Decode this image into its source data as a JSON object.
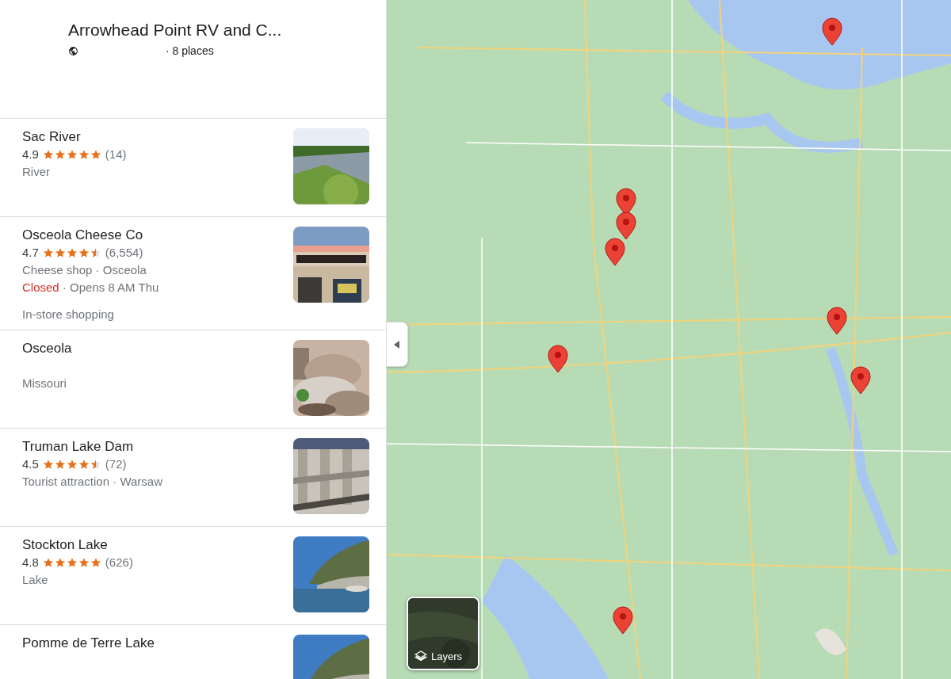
{
  "list": {
    "title": "Arrowhead Point RV and C...",
    "count": "· 8 places"
  },
  "places": [
    {
      "kind": "rated",
      "name": "Sac River",
      "rating": "4.9",
      "stars": 5,
      "reviews": "(14)",
      "lines": [
        "River"
      ]
    },
    {
      "kind": "rated",
      "name": "Osceola Cheese Co",
      "rating": "4.7",
      "stars": 4.5,
      "reviews": "(6,554)",
      "lines": [
        "Cheese shop · Osceola"
      ],
      "status": "Closed",
      "hours": "· Opens 8 AM Thu",
      "feature": "In-store shopping"
    },
    {
      "kind": "plain",
      "name": "Osceola",
      "lines": [
        "Missouri"
      ]
    },
    {
      "kind": "rated",
      "name": "Truman Lake Dam",
      "rating": "4.5",
      "stars": 4.5,
      "reviews": "(72)",
      "lines": [
        "Tourist attraction · Warsaw"
      ]
    },
    {
      "kind": "rated",
      "name": "Stockton Lake",
      "rating": "4.8",
      "stars": 5,
      "reviews": "(626)",
      "lines": [
        "Lake"
      ]
    },
    {
      "kind": "plain",
      "name": "Pomme de Terre Lake"
    }
  ],
  "layers_button": {
    "label": "Layers"
  }
}
